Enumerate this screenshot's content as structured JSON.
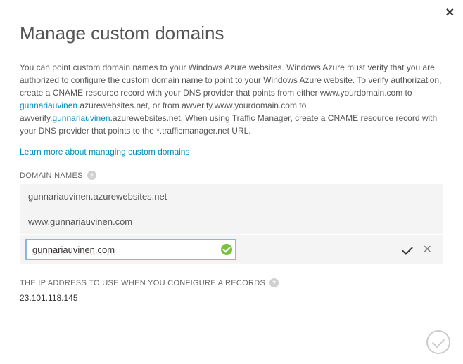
{
  "title": "Manage custom domains",
  "description": {
    "p1a": "You can point custom domain names to your Windows Azure websites. Windows Azure must verify that you are authorized to configure the custom domain name to point to your Windows Azure website. To verify authorization, create a CNAME resource record with your DNS provider that points from either www.yourdomain.com to ",
    "link1": "gunnariauvinen",
    "p1b": ".azurewebsites.net, or from awverify.www.yourdomain.com to awverify.",
    "link2": "gunnariauvinen",
    "p1c": ".azurewebsites.net. When using Traffic Manager, create a CNAME resource record with your DNS provider that points to the *.trafficmanager.net URL."
  },
  "learn_more": "Learn more about managing custom domains",
  "domain_names_label": "DOMAIN NAMES",
  "domain_rows": {
    "0": "gunnariauvinen.azurewebsites.net",
    "1": "www.gunnariauvinen.com"
  },
  "domain_input_value": "gunnariauvinen.com",
  "ip_label": "THE IP ADDRESS TO USE WHEN YOU CONFIGURE A RECORDS",
  "ip_value": "23.101.118.145",
  "help_glyph": "?"
}
